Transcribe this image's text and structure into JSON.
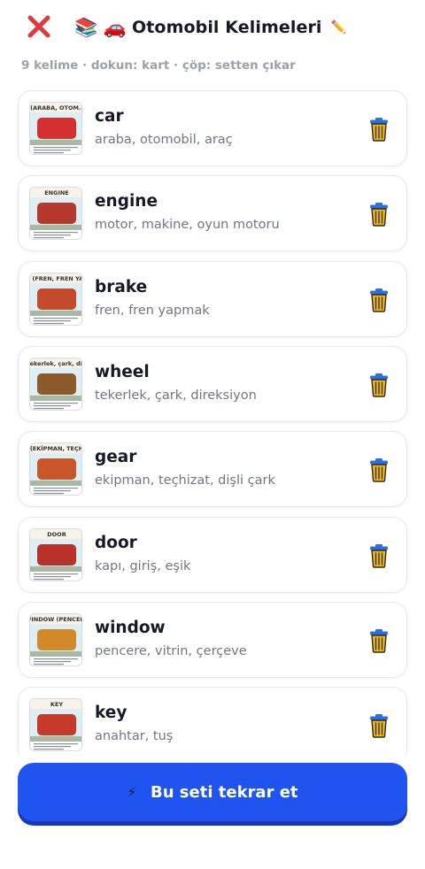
{
  "header": {
    "title_emoji": "📚 🚗",
    "title": "Otomobil Kelimeleri",
    "edit_icon": "✏️"
  },
  "subtitle": "9 kelime · dokun: kart · çöp: setten çıkar",
  "words": [
    {
      "word": "car",
      "meaning": "araba, otomobil, araç",
      "thumb": "car-thumbnail",
      "thumb_text": "(ARABA, OTOM..",
      "accent": "#d62f2f"
    },
    {
      "word": "engine",
      "meaning": "motor, makine, oyun motoru",
      "thumb": "engine-thumbnail",
      "thumb_text": "ENGINE",
      "accent": "#b5382c"
    },
    {
      "word": "brake",
      "meaning": "fren, fren yapmak",
      "thumb": "brake-thumbnail",
      "thumb_text": "BRAKE (FREN, FREN YAPMAK)",
      "accent": "#c44a2c"
    },
    {
      "word": "wheel",
      "meaning": "tekerlek, çark, direksiyon",
      "thumb": "wheel-thumbnail",
      "thumb_text": "(tekerlek, çark, dire",
      "accent": "#8a5a2b"
    },
    {
      "word": "gear",
      "meaning": "ekipman, teçhizat, dişli çark",
      "thumb": "gear-thumbnail",
      "thumb_text": "(EKİPMAN, TEÇH",
      "accent": "#c9552a"
    },
    {
      "word": "door",
      "meaning": "kapı, giriş, eşik",
      "thumb": "door-thumbnail",
      "thumb_text": "DOOR",
      "accent": "#b8322a"
    },
    {
      "word": "window",
      "meaning": "pencere, vitrin, çerçeve",
      "thumb": "window-thumbnail",
      "thumb_text": "WINDOW (PENCERE",
      "accent": "#d08a2a"
    },
    {
      "word": "key",
      "meaning": "anahtar, tuş",
      "thumb": "key-thumbnail",
      "thumb_text": "KEY",
      "accent": "#c73a2a"
    }
  ],
  "footer": {
    "repeat_icon": "⚡",
    "repeat_label": "Bu seti tekrar et"
  },
  "colors": {
    "primary": "#1f54f0",
    "close": "#e0393e",
    "trash_body": "#f2b705",
    "trash_lid": "#2c6fe0"
  }
}
